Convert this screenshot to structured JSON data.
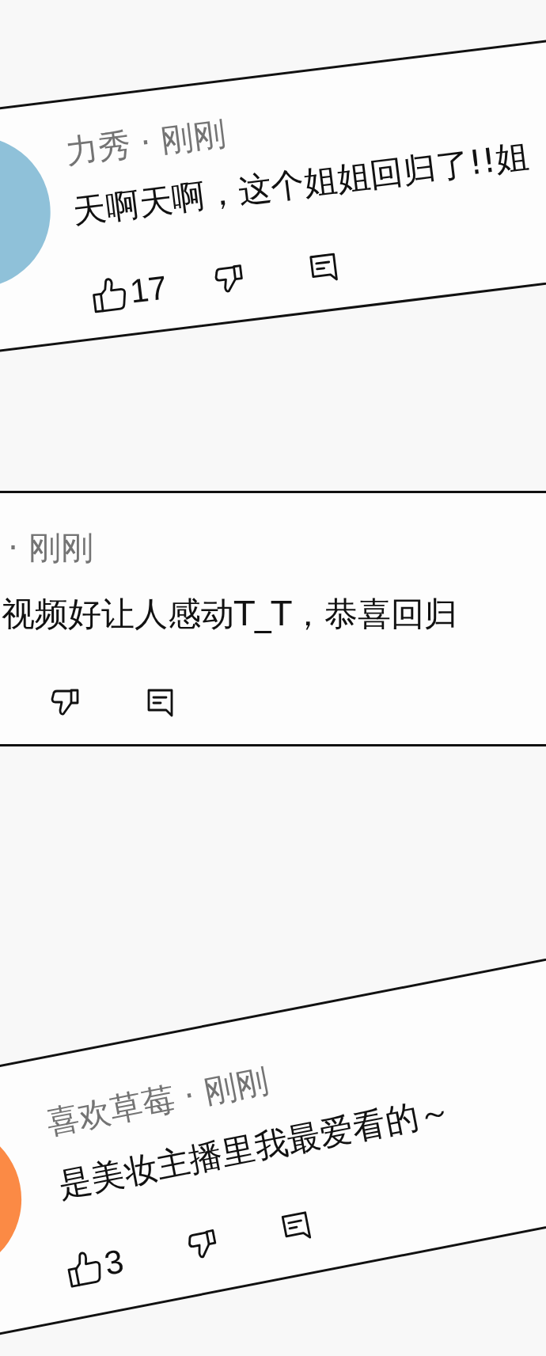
{
  "comments": [
    {
      "avatar": {
        "color": "#8fc1d9"
      },
      "meta": "力秀 · 刚刚",
      "text": "天啊天啊，这个姐姐回归了!!姐",
      "likes": "17"
    },
    {
      "meta": "· 刚刚",
      "text": "视频好让人感动T_T，恭喜回归"
    },
    {
      "avatar": {
        "color": "#fb8a45"
      },
      "meta": "喜欢草莓 · 刚刚",
      "text": "是美妆主播里我最爱看的～",
      "likes": "3"
    }
  ]
}
